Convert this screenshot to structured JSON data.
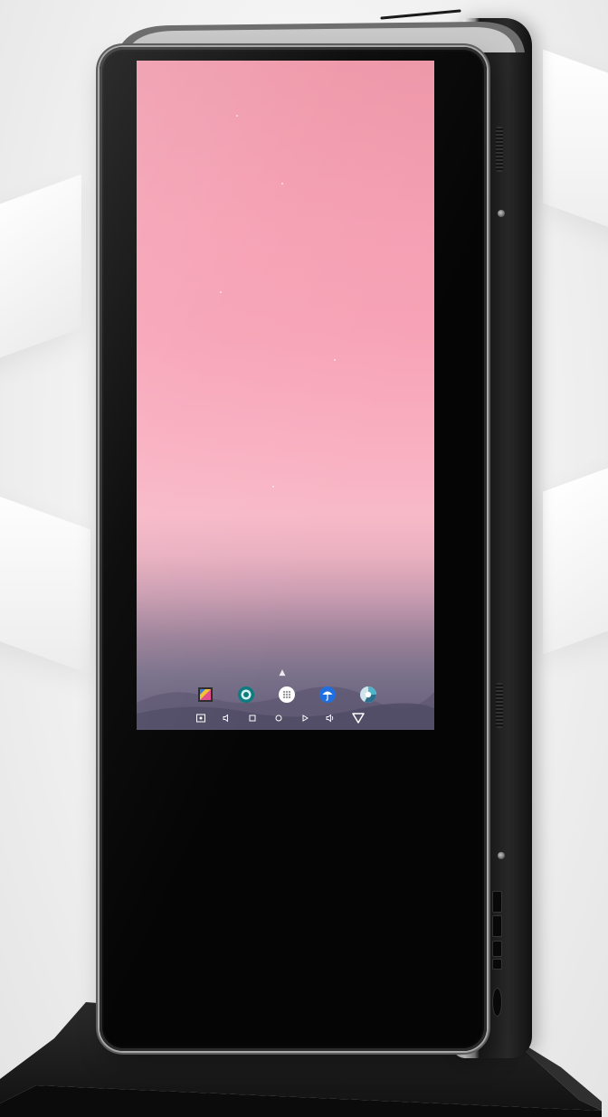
{
  "scene": {
    "subject": "",
    "colors": {
      "backdrop": "#f1f1f1",
      "bezel": "#050505",
      "chassis_trim": "#a9a9a9",
      "screen_top": "#ee96a8",
      "screen_mid": "#f9b0c1",
      "screen_bottom": "#645e78",
      "stand": "#151515"
    }
  },
  "screen": {
    "dock_apps": [
      {
        "icon": "photos-app-icon"
      },
      {
        "icon": "camera-app-icon"
      },
      {
        "icon": "app-drawer-icon"
      },
      {
        "icon": "weather-app-icon"
      },
      {
        "icon": "browser-app-icon"
      }
    ],
    "nav_buttons": [
      {
        "icon": "screenshot-icon"
      },
      {
        "icon": "volume-down-icon"
      },
      {
        "icon": "square-icon"
      },
      {
        "icon": "circle-icon"
      },
      {
        "icon": "play-icon"
      },
      {
        "icon": "volume-up-icon"
      },
      {
        "icon": "back-triangle-icon"
      }
    ]
  }
}
